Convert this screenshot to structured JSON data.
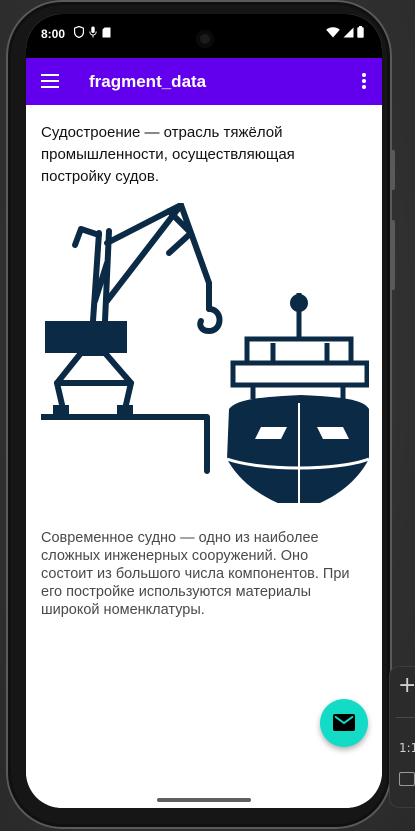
{
  "status": {
    "time": "8:00"
  },
  "appbar": {
    "title": "fragment_data",
    "menu_icon": "menu-icon",
    "overflow_icon": "more-vert-icon",
    "color": "#6200ee"
  },
  "content": {
    "intro": "Судостроение — отрасль тяжёлой промышленности, осуществляющая постройку судов.",
    "body": " Современное судно — одно из наиболее сложных инженерных сооружений. Оно состоит из большого числа компонентов. При его постройке используются материалы широкой номенклатуры.",
    "illustration_icon": "shipyard-crane-ship-illustration",
    "illustration_color": "#0b2a45"
  },
  "fab": {
    "icon": "email-icon",
    "color": "#13dbc6"
  },
  "side_panel": {
    "plus": "+",
    "ratio": "1:1"
  }
}
